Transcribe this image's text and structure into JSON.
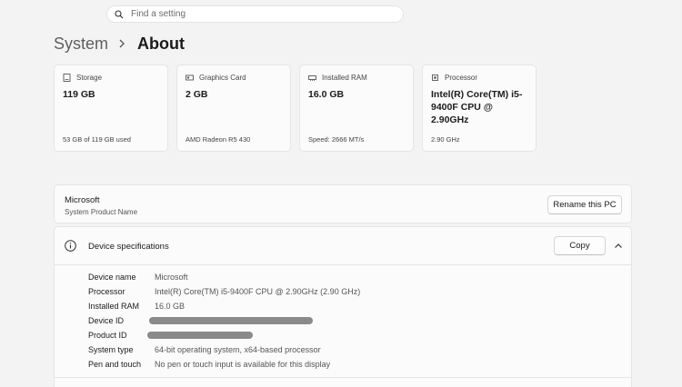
{
  "search": {
    "placeholder": "Find a setting",
    "icon": "search-icon"
  },
  "breadcrumb": {
    "parent": "System",
    "current": "About"
  },
  "cards": [
    {
      "label": "Storage",
      "value": "119 GB",
      "sub": "53 GB of 119 GB used",
      "icon": "storage-icon"
    },
    {
      "label": "Graphics Card",
      "value": "2 GB",
      "sub": "AMD Radeon R5 430",
      "icon": "graphics-card-icon"
    },
    {
      "label": "Installed RAM",
      "value": "16.0 GB",
      "sub": "Speed: 2666 MT/s",
      "icon": "ram-icon"
    },
    {
      "label": "Processor",
      "value": "Intel(R) Core(TM) i5-9400F CPU @ 2.90GHz",
      "sub": "2.90 GHz",
      "icon": "processor-icon"
    }
  ],
  "device": {
    "name": "Microsoft",
    "sub": "System Product Name",
    "rename_label": "Rename this PC"
  },
  "specs": {
    "title": "Device specifications",
    "copy_label": "Copy",
    "rows": [
      {
        "key": "Device name",
        "value": "Microsoft"
      },
      {
        "key": "Processor",
        "value": "Intel(R) Core(TM) i5-9400F CPU @ 2.90GHz (2.90 GHz)"
      },
      {
        "key": "Installed RAM",
        "value": "16.0 GB"
      },
      {
        "key": "Device ID",
        "value": "",
        "redacted": true
      },
      {
        "key": "Product ID",
        "value": "",
        "redacted": true
      },
      {
        "key": "System type",
        "value": "64-bit operating system, x64-based processor"
      },
      {
        "key": "Pen and touch",
        "value": "No pen or touch input is available for this display"
      }
    ]
  }
}
